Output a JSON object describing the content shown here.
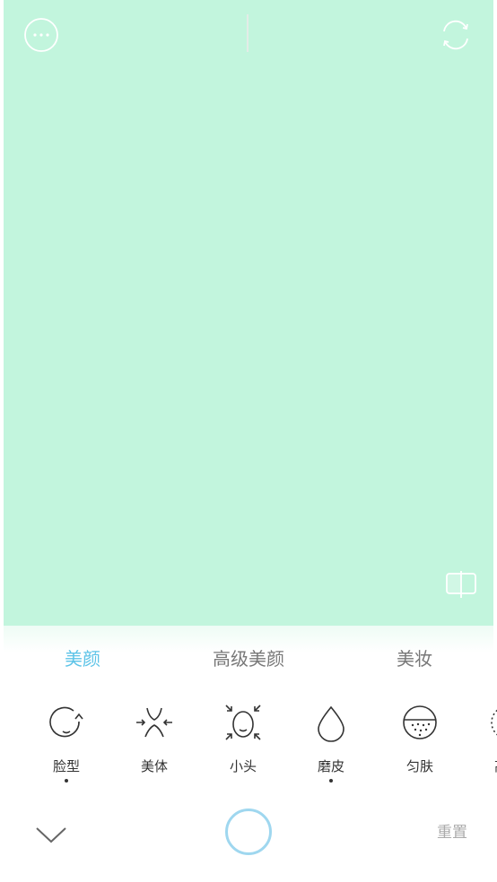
{
  "top_bar": {
    "more_icon": "ellipsis-circle-icon",
    "rotate_icon": "switch-camera-icon"
  },
  "preview": {
    "background_color": "#c2f5dd",
    "compare_icon": "compare-icon"
  },
  "tabs": [
    {
      "label": "美颜",
      "active": true
    },
    {
      "label": "高级美颜",
      "active": false
    },
    {
      "label": "美妆",
      "active": false
    }
  ],
  "tools": [
    {
      "label": "脸型",
      "icon": "face-shape-icon",
      "modified": true
    },
    {
      "label": "美体",
      "icon": "body-slim-icon",
      "modified": false
    },
    {
      "label": "小头",
      "icon": "small-head-icon",
      "modified": false
    },
    {
      "label": "磨皮",
      "icon": "smooth-skin-drop-icon",
      "modified": true
    },
    {
      "label": "匀肤",
      "icon": "even-skin-icon",
      "modified": false
    },
    {
      "label": "高光",
      "icon": "highlight-icon",
      "modified": false
    }
  ],
  "bottom_bar": {
    "collapse_icon": "chevron-down-icon",
    "reset_label": "重置"
  },
  "colors": {
    "accent": "#5cc3e7",
    "shutter_ring": "#9fd7ef"
  }
}
